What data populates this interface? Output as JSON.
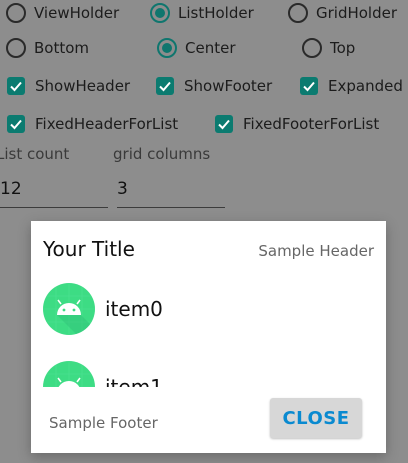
{
  "options_row1": [
    {
      "label": "ViewHolder",
      "checked": false
    },
    {
      "label": "ListHolder",
      "checked": true
    },
    {
      "label": "GridHolder",
      "checked": false
    }
  ],
  "options_row2": [
    {
      "label": "Bottom",
      "checked": false
    },
    {
      "label": "Center",
      "checked": true
    },
    {
      "label": "Top",
      "checked": false
    }
  ],
  "checkboxes_row1": [
    {
      "label": "ShowHeader",
      "checked": true
    },
    {
      "label": "ShowFooter",
      "checked": true
    },
    {
      "label": "Expanded",
      "checked": true
    }
  ],
  "checkboxes_row2": [
    {
      "label": "FixedHeaderForList",
      "checked": true
    },
    {
      "label": "FixedFooterForList",
      "checked": true
    }
  ],
  "inputs": {
    "list_count_label": "List count",
    "list_count_value": "12",
    "grid_columns_label": "grid columns",
    "grid_columns_value": "3"
  },
  "dialog": {
    "title": "Your Title",
    "header": "Sample Header",
    "items": [
      "item0",
      "item1"
    ],
    "footer": "Sample Footer",
    "close_label": "CLOSE"
  },
  "colors": {
    "accent": "#0f766e",
    "button_text": "#0a8ad0",
    "android_green": "#3ddc84",
    "scrim": "#8d8d8d"
  }
}
